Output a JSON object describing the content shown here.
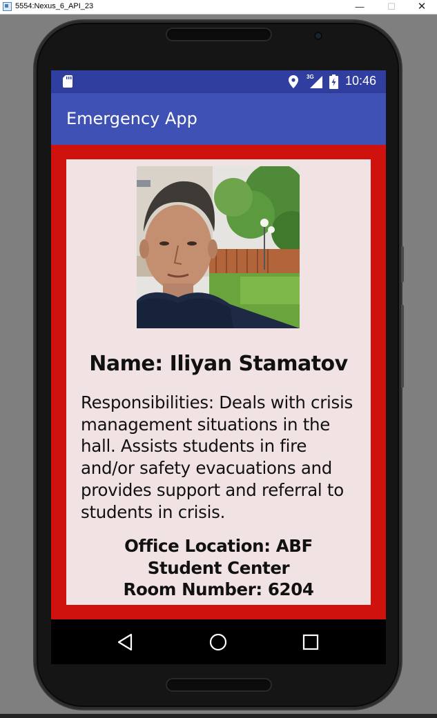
{
  "window": {
    "title": "5554:Nexus_6_API_23",
    "minimize_glyph": "—",
    "maximize_glyph": "☐",
    "close_glyph": "✕"
  },
  "status_bar": {
    "time": "10:46",
    "network_type": "3G",
    "icons": [
      "sd-card-icon",
      "location-icon",
      "signal-icon",
      "battery-icon"
    ],
    "color": "#303f9f"
  },
  "app_bar": {
    "title": "Emergency App",
    "color": "#3f51b5"
  },
  "content": {
    "background_color": "#d0120e",
    "card_color": "#f1e3e3",
    "photo": "person-photo",
    "name": "Name: Iliyan Stamatov",
    "responsibilities": "Responsibilities: Deals with crisis management situations in the hall. Assists students in fire and/or safety evacuations and provides support and referral to students in crisis.",
    "office_location": "Office Location: ABF Student Center",
    "room_number": "Room Number: 6204"
  },
  "nav_bar": {
    "buttons": [
      "back-icon",
      "home-icon",
      "recents-icon"
    ]
  }
}
